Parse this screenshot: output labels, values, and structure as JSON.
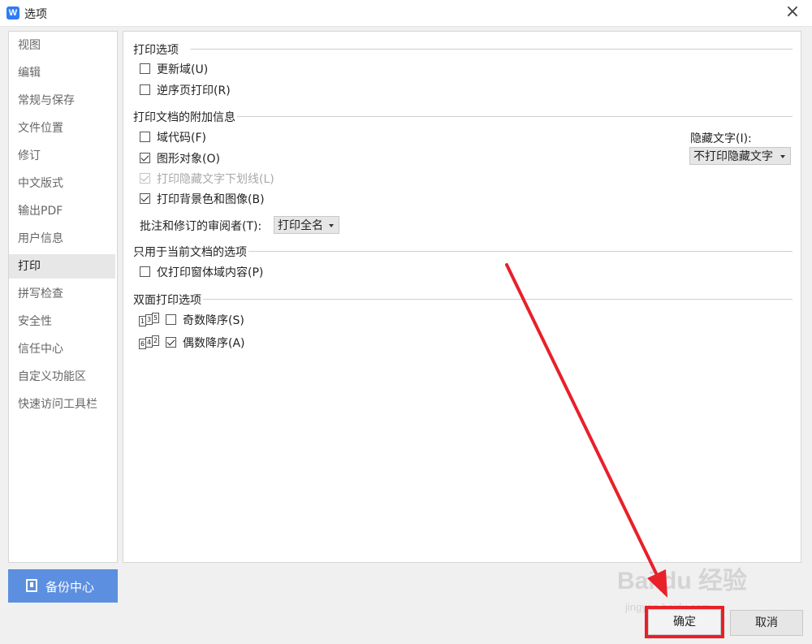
{
  "window": {
    "title": "选项",
    "app_icon_glyph": "W"
  },
  "sidebar": {
    "items": [
      {
        "label": "视图"
      },
      {
        "label": "编辑"
      },
      {
        "label": "常规与保存"
      },
      {
        "label": "文件位置"
      },
      {
        "label": "修订"
      },
      {
        "label": "中文版式"
      },
      {
        "label": "输出PDF"
      },
      {
        "label": "用户信息"
      },
      {
        "label": "打印",
        "active": true
      },
      {
        "label": "拼写检查"
      },
      {
        "label": "安全性"
      },
      {
        "label": "信任中心"
      },
      {
        "label": "自定义功能区"
      },
      {
        "label": "快速访问工具栏"
      }
    ],
    "backup_label": "备份中心"
  },
  "print_options": {
    "title": "打印选项",
    "update_fields": {
      "label": "更新域(U)",
      "checked": false
    },
    "reverse_order": {
      "label": "逆序页打印(R)",
      "checked": false
    }
  },
  "extra_info": {
    "title": "打印文档的附加信息",
    "field_codes": {
      "label": "域代码(F)",
      "checked": false
    },
    "drawing_objects": {
      "label": "图形对象(O)",
      "checked": true
    },
    "hidden_underline": {
      "label": "打印隐藏文字下划线(L)",
      "checked": true,
      "disabled": true
    },
    "background": {
      "label": "打印背景色和图像(B)",
      "checked": true
    },
    "reviewer_label": "批注和修订的审阅者(T):",
    "reviewer_value": "打印全名",
    "hidden_text_label": "隐藏文字(I):",
    "hidden_text_value": "不打印隐藏文字"
  },
  "current_doc": {
    "title": "只用于当前文档的选项",
    "form_fields_only": {
      "label": "仅打印窗体域内容(P)",
      "checked": false
    }
  },
  "duplex": {
    "title": "双面打印选项",
    "odd_desc": {
      "label": "奇数降序(S)",
      "checked": false,
      "icon_pages": [
        "1",
        "3",
        "5"
      ]
    },
    "even_desc": {
      "label": "偶数降序(A)",
      "checked": true,
      "icon_pages": [
        "6",
        "4",
        "2"
      ]
    }
  },
  "buttons": {
    "ok": "确定",
    "cancel": "取消"
  },
  "watermark": {
    "main": "Bai du 经验",
    "sub": "jingyan.baidu.com"
  },
  "annotation": {
    "arrow_color": "#e8202a",
    "highlight_color": "#e8202a"
  }
}
